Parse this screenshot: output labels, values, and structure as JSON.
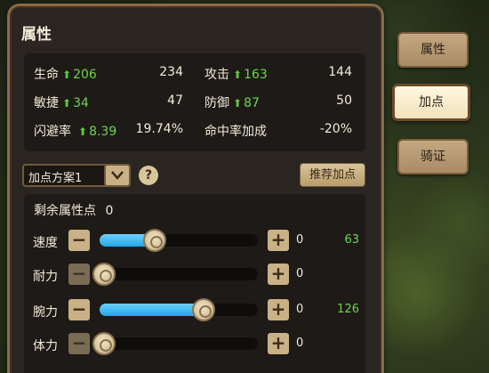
{
  "panel": {
    "title": "属性"
  },
  "stats": [
    {
      "name": "生命",
      "gain": "206",
      "value": "234"
    },
    {
      "name": "攻击",
      "gain": "163",
      "value": "144"
    },
    {
      "name": "敏捷",
      "gain": "34",
      "value": "47"
    },
    {
      "name": "防御",
      "gain": "87",
      "value": "50"
    },
    {
      "name": "闪避率",
      "gain": "8.39",
      "value": "19.74%"
    },
    {
      "name": "命中率加成",
      "gain": "",
      "value": "-20%"
    }
  ],
  "arrow_glyph": "⬆",
  "scheme": {
    "selected": "加点方案1",
    "dropdown_icon": "chevron-down-icon",
    "help_label": "?"
  },
  "recommend_label": "推荐加点",
  "remaining": {
    "label": "剩余属性点",
    "value": "0"
  },
  "attributes": [
    {
      "label": "速度",
      "level": 0.35,
      "added": "0",
      "total": "63",
      "minus": "−",
      "plus": "+"
    },
    {
      "label": "耐力",
      "level": 0.0,
      "added": "0",
      "total": "",
      "minus": "−",
      "plus": "+"
    },
    {
      "label": "腕力",
      "level": 0.66,
      "added": "0",
      "total": "126",
      "minus": "−",
      "plus": "+"
    },
    {
      "label": "体力",
      "level": 0.0,
      "added": "0",
      "total": "",
      "minus": "−",
      "plus": "+"
    }
  ],
  "tabs": [
    {
      "label": "属性",
      "active": false
    },
    {
      "label": "加点",
      "active": true
    },
    {
      "label": "骑证",
      "active": false
    }
  ],
  "colors": {
    "gain_green": "#6ed64a",
    "slider_blue": "#22a6e6",
    "accent_tan": "#c9b185"
  }
}
